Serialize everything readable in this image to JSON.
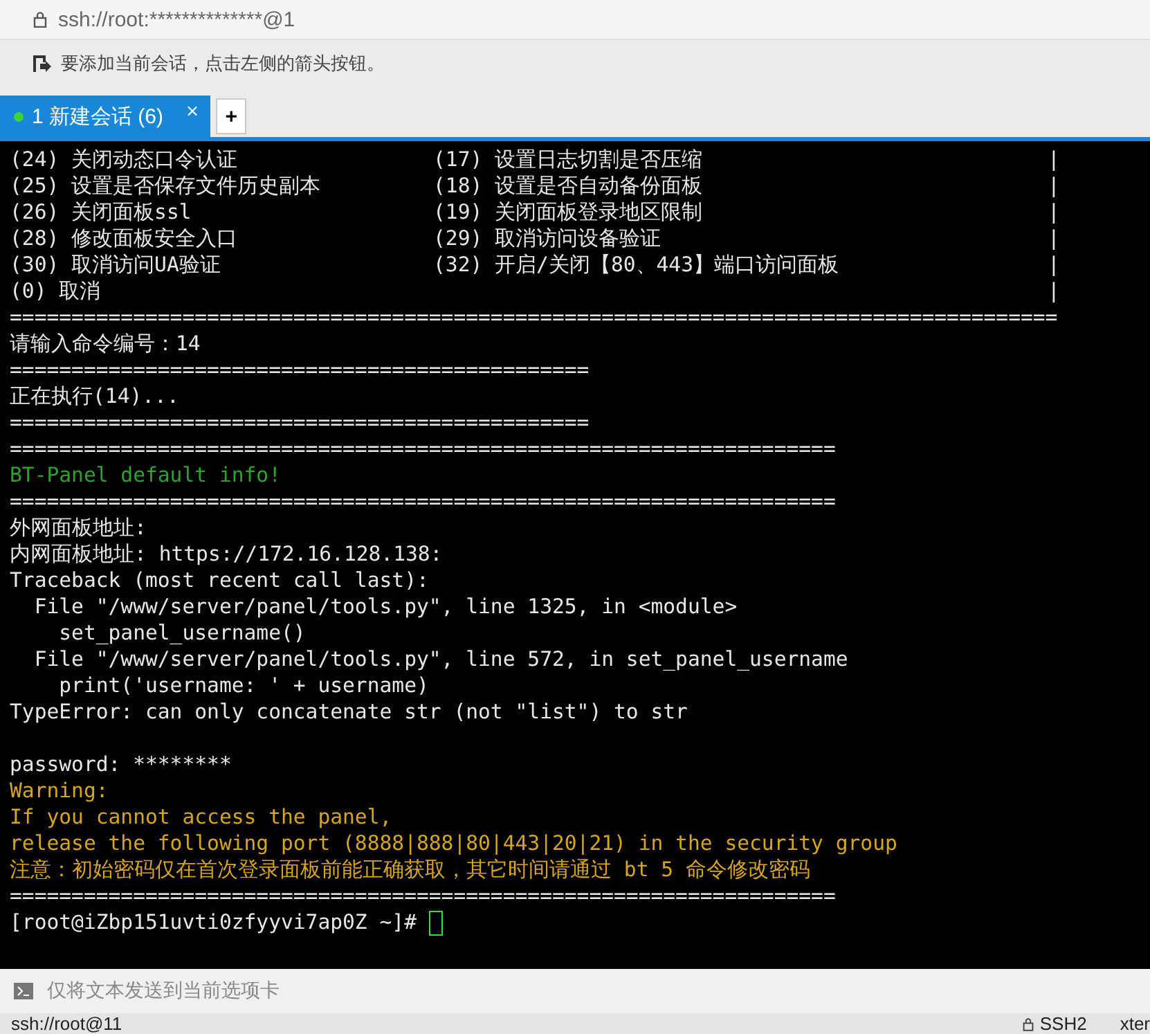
{
  "address_bar": {
    "text": "ssh://root:**************@1"
  },
  "hint_bar": {
    "text": "要添加当前会话，点击左侧的箭头按钮。"
  },
  "tabs": [
    {
      "label": "1 新建会话 (6)",
      "selected": true,
      "connected": true,
      "close": "×"
    }
  ],
  "new_tab_button": "+",
  "terminal": {
    "menu": [
      {
        "left": "(24) 关闭动态口令认证",
        "right": "(17) 设置日志切割是否压缩",
        "border": "|"
      },
      {
        "left": "(25) 设置是否保存文件历史副本",
        "right": "(18) 设置是否自动备份面板",
        "border": "|"
      },
      {
        "left": "(26) 关闭面板ssl",
        "right": "(19) 关闭面板登录地区限制",
        "border": "|"
      },
      {
        "left": "(28) 修改面板安全入口",
        "right": "(29) 取消访问设备验证",
        "border": "|"
      },
      {
        "left": "(30) 取消访问UA验证",
        "right": "(32) 开启/关闭【80、443】端口访问面板",
        "border": "|"
      },
      {
        "left": "(0) 取消",
        "border": "|"
      }
    ],
    "lines": [
      {
        "kind": "text",
        "text": "====================================================================================="
      },
      {
        "kind": "text",
        "text": "请输入命令编号：14"
      },
      {
        "kind": "text",
        "text": "==============================================="
      },
      {
        "kind": "text",
        "text": "正在执行(14)..."
      },
      {
        "kind": "text",
        "text": "==============================================="
      },
      {
        "kind": "text",
        "text": "==================================================================="
      },
      {
        "kind": "success",
        "text": "BT-Panel default info!"
      },
      {
        "kind": "text",
        "text": "==================================================================="
      },
      {
        "kind": "text",
        "text": "外网面板地址: "
      },
      {
        "kind": "text",
        "text": "内网面板地址: https://172.16.128.138:"
      },
      {
        "kind": "text",
        "text": "Traceback (most recent call last):"
      },
      {
        "kind": "text",
        "text": "  File \"/www/server/panel/tools.py\", line 1325, in <module>"
      },
      {
        "kind": "text",
        "text": "    set_panel_username()"
      },
      {
        "kind": "text",
        "text": "  File \"/www/server/panel/tools.py\", line 572, in set_panel_username"
      },
      {
        "kind": "text",
        "text": "    print('username: ' + username)"
      },
      {
        "kind": "text",
        "text": "TypeError: can only concatenate str (not \"list\") to str"
      },
      {
        "kind": "blank"
      },
      {
        "kind": "text",
        "text": "password: ********"
      },
      {
        "kind": "warning",
        "text": "Warning:"
      },
      {
        "kind": "warning",
        "text": "If you cannot access the panel,"
      },
      {
        "kind": "warning",
        "text": "release the following port (8888|888|80|443|20|21) in the security group"
      },
      {
        "kind": "warning",
        "text": "注意：初始密码仅在首次登录面板前能正确获取，其它时间请通过 bt 5 命令修改密码"
      },
      {
        "kind": "text",
        "text": "==================================================================="
      }
    ],
    "prompt": "[root@iZbp151uvti0zfyyvi7ap0Z ~]# "
  },
  "send_bar": {
    "placeholder": "仅将文本发送到当前选项卡"
  },
  "status_bar": {
    "connection": "ssh://root@11",
    "protocol": "SSH2",
    "terminal_type": "xter"
  }
}
